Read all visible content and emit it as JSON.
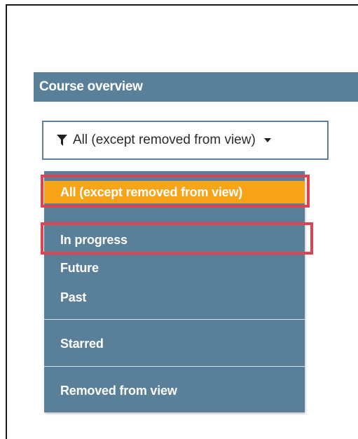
{
  "block": {
    "title": "Course overview"
  },
  "filter": {
    "label": "All (except removed from view)",
    "icon": "filter-funnel-icon",
    "caret_icon": "caret-down-icon"
  },
  "menu": {
    "items": [
      {
        "label": "All (except removed from view)",
        "selected": true
      },
      {
        "label": "In progress",
        "selected": false
      },
      {
        "label": "Future",
        "selected": false
      },
      {
        "label": "Past",
        "selected": false
      },
      {
        "label": "Starred",
        "selected": false
      },
      {
        "label": "Removed from view",
        "selected": false
      }
    ]
  },
  "colors": {
    "header_bg": "#5a7f98",
    "menu_bg": "#5a7f98",
    "active_item": "#f7a418",
    "highlight_border": "#dc4451"
  }
}
